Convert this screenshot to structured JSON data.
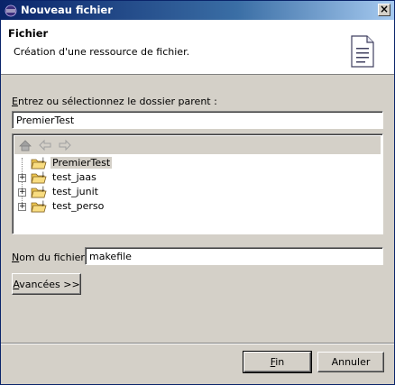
{
  "window": {
    "title": "Nouveau fichier",
    "close_label": "×"
  },
  "header": {
    "title": "Fichier",
    "description": "Création d'une ressource de fichier."
  },
  "parent_folder": {
    "label_mnemonic": "E",
    "label_rest": "ntrez ou sélectionnez le dossier parent :",
    "value": "PremierTest"
  },
  "tree": {
    "toolbar_icons": [
      "home-icon",
      "back-arrow-icon",
      "forward-arrow-icon"
    ],
    "items": [
      {
        "label": "PremierTest",
        "selected": true,
        "expandable": false
      },
      {
        "label": "test_jaas",
        "selected": false,
        "expandable": true
      },
      {
        "label": "test_junit",
        "selected": false,
        "expandable": true
      },
      {
        "label": "test_perso",
        "selected": false,
        "expandable": true
      }
    ]
  },
  "file_name": {
    "label_mnemonic": "N",
    "label_rest": "om du fichier :",
    "value": "makefile"
  },
  "advanced_button": {
    "mnemonic": "A",
    "rest": "vancées >>"
  },
  "footer": {
    "finish_mnemonic": "F",
    "finish_rest": "in",
    "cancel_label": "Annuler"
  },
  "colors": {
    "titlebar_start": "#0a246a",
    "dialog_bg": "#d4d0c8",
    "folder_yellow": "#f0c850"
  }
}
